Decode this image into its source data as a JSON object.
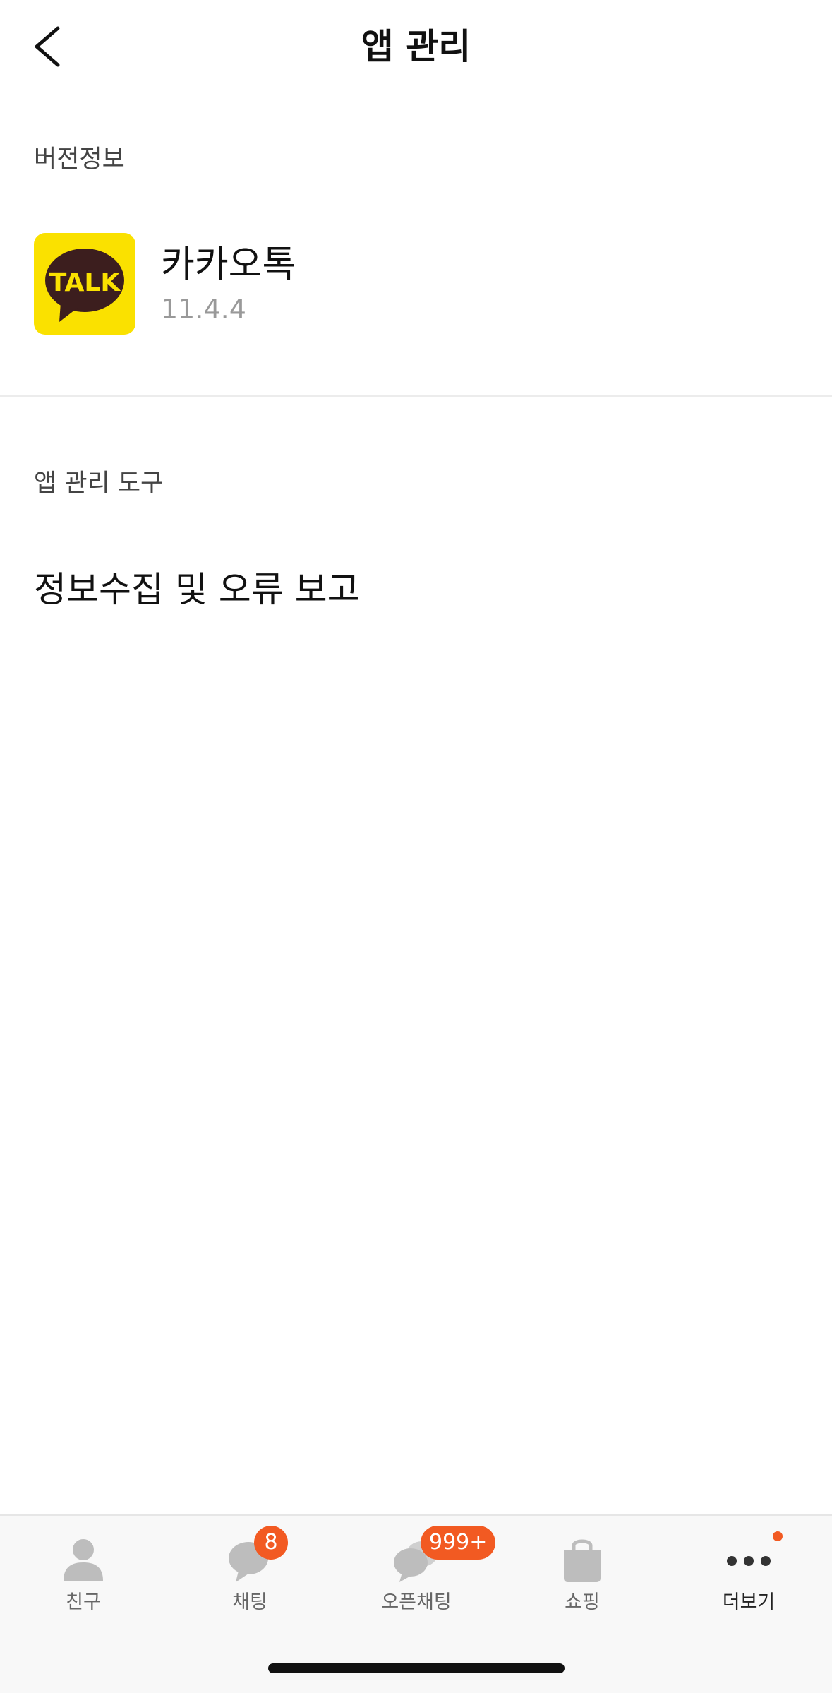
{
  "header": {
    "title": "앱 관리",
    "back_icon": "chevron-left-icon"
  },
  "version_section": {
    "label": "버전정보",
    "app": {
      "icon": "kakaotalk-logo-icon",
      "icon_text": "TALK",
      "icon_bg": "#FAE100",
      "icon_bubble": "#3C1E1E",
      "name": "카카오톡",
      "version": "11.4.4"
    }
  },
  "tools_section": {
    "label": "앱 관리 도구",
    "items": [
      {
        "label": "정보수집 및 오류 보고"
      }
    ]
  },
  "tabbar": {
    "tabs": [
      {
        "label": "친구",
        "icon": "person-icon",
        "active": false
      },
      {
        "label": "채팅",
        "icon": "chat-bubble-icon",
        "active": false,
        "badge": "8"
      },
      {
        "label": "오픈채팅",
        "icon": "open-chat-icon",
        "active": false,
        "badge": "999+"
      },
      {
        "label": "쇼핑",
        "icon": "shopping-bag-icon",
        "active": false
      },
      {
        "label": "더보기",
        "icon": "more-dots-icon",
        "active": true,
        "dot": true
      }
    ],
    "badge_color": "#F25A22"
  }
}
